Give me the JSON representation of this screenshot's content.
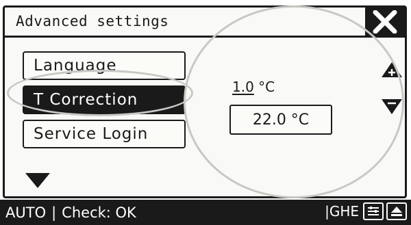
{
  "window": {
    "title": "Advanced settings"
  },
  "menu": {
    "items": [
      {
        "label": "Language",
        "selected": false
      },
      {
        "label": "T Correction",
        "selected": true
      },
      {
        "label": "Service Login",
        "selected": false
      }
    ]
  },
  "editor": {
    "step_value": "1.0",
    "step_unit": "°C",
    "current_value": "22.0 °C"
  },
  "status_bar": {
    "mode": "AUTO",
    "separator": "|",
    "check": "Check: OK",
    "right_label": "|GHE"
  },
  "icons": {
    "close": "close-x-icon",
    "scroll_down": "triangle-down-icon",
    "increase": "plus-triangle-up-icon",
    "decrease": "minus-triangle-down-icon",
    "status_1": "sliders-icon",
    "status_2": "eject-icon"
  }
}
